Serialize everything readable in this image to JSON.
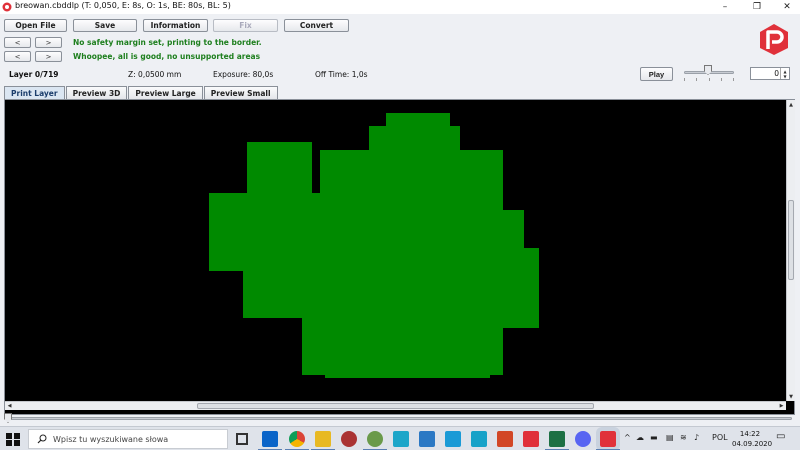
{
  "window": {
    "title": "breowan.cbddlp (T: 0,050, E: 8s, O: 1s, BE: 80s, BL: 5)",
    "minimize_glyph": "–",
    "restore_glyph": "❐",
    "close_glyph": "✕"
  },
  "toolbar": {
    "open_file": "Open File",
    "save": "Save",
    "information": "Information",
    "fix": "Fix",
    "convert": "Convert"
  },
  "messages": {
    "prev": "<",
    "next": ">",
    "line1": "No safety margin set, printing to the border.",
    "line2": "Whoopee, all is good, no unsupported areas"
  },
  "info": {
    "layer": "Layer 0/719",
    "z": "Z: 0,0500 mm",
    "exposure": "Exposure: 80,0s",
    "off_time": "Off Time: 1,0s"
  },
  "playback": {
    "play": "Play",
    "spinner_value": "0"
  },
  "tabs": [
    "Print Layer",
    "Preview 3D",
    "Preview Large",
    "Preview Small"
  ],
  "taskbar": {
    "search_placeholder": "Wpisz tu wyszukiwane słowa",
    "language": "POL",
    "time": "14:22",
    "date": "04.09.2020"
  },
  "colors": {
    "layer_fill": "#008a00",
    "canvas_bg": "#000000",
    "message_green": "#1e7f1e",
    "brand_red": "#e0313a"
  }
}
